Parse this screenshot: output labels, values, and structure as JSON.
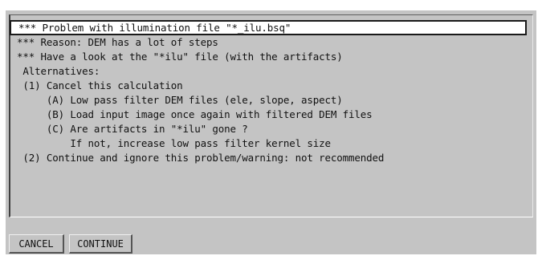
{
  "dialog": {
    "lines": [
      "*** Problem with illumination file \"*_ilu.bsq\"",
      "*** Reason: DEM has a lot of steps",
      "*** Have a look at the \"*ilu\" file (with the artifacts)",
      " Alternatives:",
      " (1) Cancel this calculation",
      "     (A) Low pass filter DEM files (ele, slope, aspect)",
      "     (B) Load input image once again with filtered DEM files",
      "     (C) Are artifacts in \"*ilu\" gone ?",
      "         If not, increase low pass filter kernel size",
      " (2) Continue and ignore this problem/warning: not recommended"
    ]
  },
  "buttons": {
    "cancel_label": "CANCEL",
    "continue_label": "CONTINUE"
  }
}
